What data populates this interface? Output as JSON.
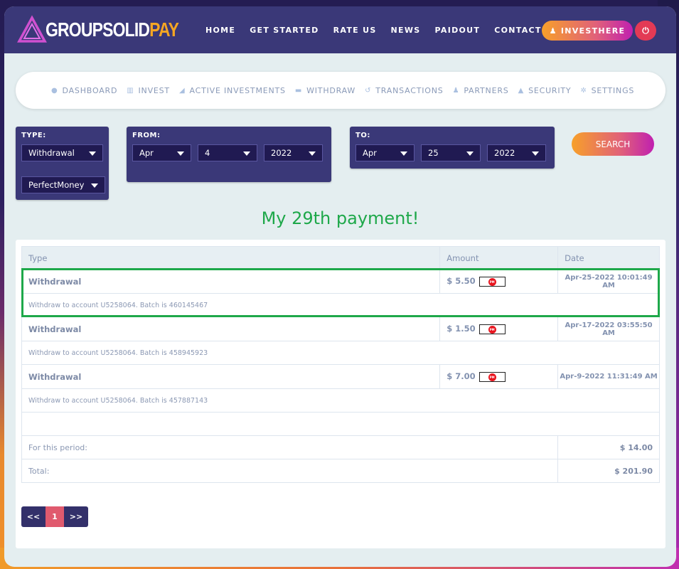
{
  "brand": {
    "part1": "GROUPSOLID",
    "part2": "PAY"
  },
  "topnav": {
    "items": [
      "HOME",
      "GET STARTED",
      "RATE US",
      "NEWS",
      "PAIDOUT",
      "CONTACT US"
    ],
    "invest_button": "INVESTHERE",
    "power_icon": "power-icon",
    "user_icon": "user-icon"
  },
  "subnav": {
    "items": [
      {
        "label": "DASHBOARD",
        "icon": "user-circle-icon",
        "glyph": "●"
      },
      {
        "label": "INVEST",
        "icon": "bank-icon",
        "glyph": "▥"
      },
      {
        "label": "ACTIVE INVESTMENTS",
        "icon": "area-chart-icon",
        "glyph": "◢"
      },
      {
        "label": "WITHDRAW",
        "icon": "credit-card-icon",
        "glyph": "▬"
      },
      {
        "label": "TRANSACTIONS",
        "icon": "history-icon",
        "glyph": "↺"
      },
      {
        "label": "PARTNERS",
        "icon": "users-icon",
        "glyph": "♟"
      },
      {
        "label": "SECURITY",
        "icon": "lock-icon",
        "glyph": "▲"
      },
      {
        "label": "SETTINGS",
        "icon": "gear-icon",
        "glyph": "✲"
      }
    ]
  },
  "filters": {
    "type_label": "TYPE:",
    "type_value": "Withdrawal",
    "method_value": "PerfectMoney",
    "from_label": "FROM:",
    "from_month": "Apr",
    "from_day": "4",
    "from_year": "2022",
    "to_label": "TO:",
    "to_month": "Apr",
    "to_day": "25",
    "to_year": "2022",
    "search_button": "SEARCH"
  },
  "headline": "My 29th payment!",
  "table": {
    "headers": {
      "type": "Type",
      "amount": "Amount",
      "date": "Date"
    },
    "rows": [
      {
        "type": "Withdrawal",
        "amount": "$ 5.50",
        "date": "Apr-25-2022 10:01:49 AM",
        "description": "Withdraw to account U5258064. Batch is 460145467",
        "badge": "PM"
      },
      {
        "type": "Withdrawal",
        "amount": "$ 1.50",
        "date": "Apr-17-2022 03:55:50 AM",
        "description": "Withdraw to account U5258064. Batch is 458945923",
        "badge": "PM"
      },
      {
        "type": "Withdrawal",
        "amount": "$ 7.00",
        "date": "Apr-9-2022 11:31:49 AM",
        "description": "Withdraw to account U5258064. Batch is 457887143",
        "badge": "PM"
      }
    ],
    "period_label": "For this period:",
    "period_value": "$ 14.00",
    "total_label": "Total:",
    "total_value": "$ 201.90"
  },
  "pagination": {
    "prev": "<<",
    "current": "1",
    "next": ">>"
  },
  "colors": {
    "accent_green": "#1ea84a",
    "nav_bg": "#3a3878",
    "pager_current": "#e05a6e"
  }
}
